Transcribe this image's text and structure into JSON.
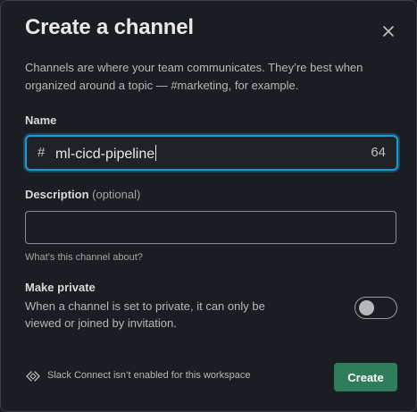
{
  "dialog": {
    "title": "Create a channel",
    "intro": "Channels are where your team communicates. They’re best when organized around a topic — #marketing, for example."
  },
  "name_field": {
    "label": "Name",
    "prefix": "#",
    "value": "ml-cicd-pipeline",
    "remaining_chars": "64"
  },
  "description_field": {
    "label": "Description",
    "optional": "(optional)",
    "value": "",
    "hint": "What’s this channel about?"
  },
  "private": {
    "label": "Make private",
    "description": "When a channel is set to private, it can only be viewed or joined by invitation.",
    "enabled": false
  },
  "footer": {
    "connect_icon": "slack-connect-icon",
    "connect_text": "Slack Connect isn’t enabled for this workspace",
    "create_label": "Create"
  },
  "colors": {
    "background": "#1a1d21",
    "focus_border": "#1d9bd1",
    "create_button": "#2e7d5b"
  }
}
